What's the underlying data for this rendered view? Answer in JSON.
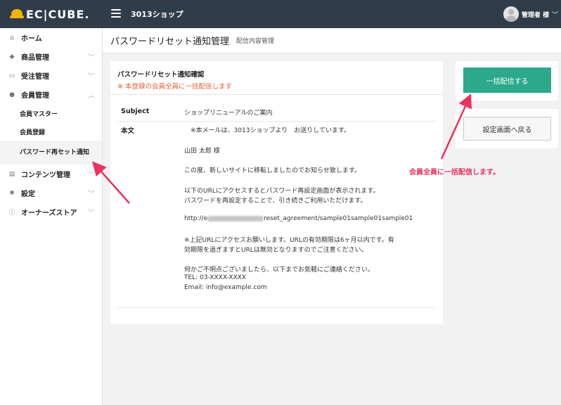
{
  "header": {
    "logo_text": "EC|CUBE.",
    "shop_name": "3013ショップ",
    "user_name": "管理者 様",
    "user_caret": "﹀"
  },
  "sidebar": {
    "items": [
      {
        "icon": "home-icon",
        "glyph": "⌂",
        "label": "ホーム",
        "chevron": ""
      },
      {
        "icon": "tag-icon",
        "glyph": "◆",
        "label": "商品管理",
        "chevron": "﹀"
      },
      {
        "icon": "cart-icon",
        "glyph": "▭",
        "label": "受注管理",
        "chevron": "﹀"
      },
      {
        "icon": "users-icon",
        "glyph": "●",
        "label": "会員管理",
        "chevron": "︿"
      },
      {
        "icon": "file-icon",
        "glyph": "▤",
        "label": "コンテンツ管理",
        "chevron": "﹀"
      },
      {
        "icon": "gear-icon",
        "glyph": "✱",
        "label": "設定",
        "chevron": "﹀"
      },
      {
        "icon": "info-icon",
        "glyph": "ⓘ",
        "label": "オーナーズストア",
        "chevron": "﹀"
      }
    ],
    "subitems": [
      {
        "label": "会員マスター"
      },
      {
        "label": "会員登録"
      },
      {
        "label": "パスワード再セット通知"
      }
    ]
  },
  "page": {
    "title": "パスワードリセット通知管理",
    "subtitle": "配信内容管理"
  },
  "card": {
    "title": "パスワードリセット通知確認",
    "warning": "※ 本登録の会員全員に一括配信します",
    "subject_key": "Subject",
    "subject_value": "ショップリニューアルのご案内",
    "body_key": "本文",
    "body_lines": [
      "　※本メールは、3013ショップより　お送りしています。",
      "山田 太郎 様",
      "この度、新しいサイトに移転しましたのでお知らせ致します。",
      "以下のURLにアクセスするとパスワード再設定画面が表示されます。",
      "パスワードを再設定することで、引き続きご利用いただけます。",
      "http://e",
      "reset_agreement/sample01sample01sample01",
      "※上記URLにアクセスお願いします。URLの有効期限は6ヶ月以内です。有",
      "効期限を過ぎますとURLは無効となりますのでご注意ください。",
      "何かご不明点ございましたら、以下までお気軽にご連絡ください。",
      "TEL: 03-XXXX-XXXX",
      "Email: info@example.com"
    ]
  },
  "actions": {
    "send_label": "一括配信する",
    "back_label": "設定画面へ戻る"
  },
  "annotation": {
    "callout": "会員全員に一括配信します。",
    "color": "#e8335f"
  },
  "colors": {
    "topbar": "#2f3d4a",
    "accent": "#2ba98a",
    "warning": "#e35c3c"
  }
}
